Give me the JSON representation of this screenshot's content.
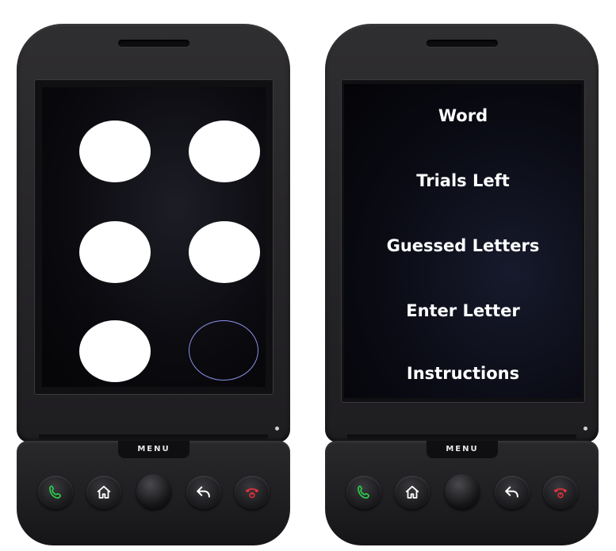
{
  "left_phone": {
    "menu_key_label": "MENU",
    "braille_cell": {
      "dots": [
        {
          "position": 1,
          "raised": true
        },
        {
          "position": 4,
          "raised": true
        },
        {
          "position": 2,
          "raised": true
        },
        {
          "position": 5,
          "raised": true
        },
        {
          "position": 3,
          "raised": true
        },
        {
          "position": 6,
          "raised": false
        }
      ]
    }
  },
  "right_phone": {
    "menu_key_label": "MENU",
    "menu": {
      "items": [
        {
          "label": "Word"
        },
        {
          "label": "Trials Left"
        },
        {
          "label": "Guessed Letters"
        },
        {
          "label": "Enter Letter"
        },
        {
          "label": "Instructions"
        }
      ]
    }
  },
  "hardware_keys": {
    "icons": [
      "call-icon",
      "home-icon",
      "trackball",
      "back-icon",
      "end-call-icon"
    ]
  },
  "colors": {
    "dot_fill": "#ffffff",
    "empty_dot_outline": "#8b8fe8",
    "call_key_icon": "#2bd24a",
    "end_key_icon": "#e8313c",
    "menu_text": "#ffffff"
  }
}
